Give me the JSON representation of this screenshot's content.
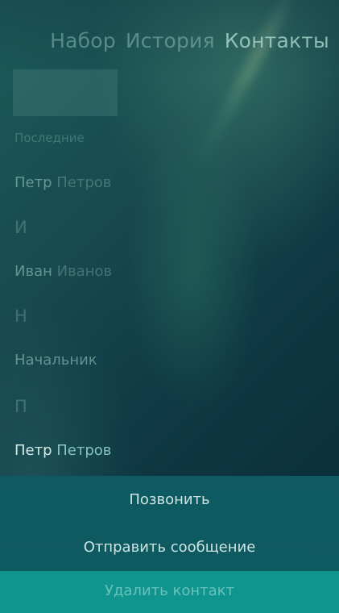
{
  "tabs": [
    {
      "label": "Набор"
    },
    {
      "label": "История"
    },
    {
      "label": "Контакты"
    }
  ],
  "list": {
    "recent_header": "Последние",
    "recent_contact": {
      "first": "Петр",
      "last": "Петров"
    },
    "section_i": "И",
    "contact_ivan": {
      "first": "Иван",
      "last": "Иванов"
    },
    "section_n": "Н",
    "contact_boss": {
      "name": "Начальник"
    },
    "section_p": "П",
    "contact_petr": {
      "first": "Петр",
      "last": "Петров"
    }
  },
  "context_menu": {
    "call": "Позвонить",
    "send_message": "Отправить сообщение",
    "delete_contact": "Удалить контакт"
  },
  "colors": {
    "menu_background": "#0f5a62",
    "delete_background": "#0f948e"
  }
}
